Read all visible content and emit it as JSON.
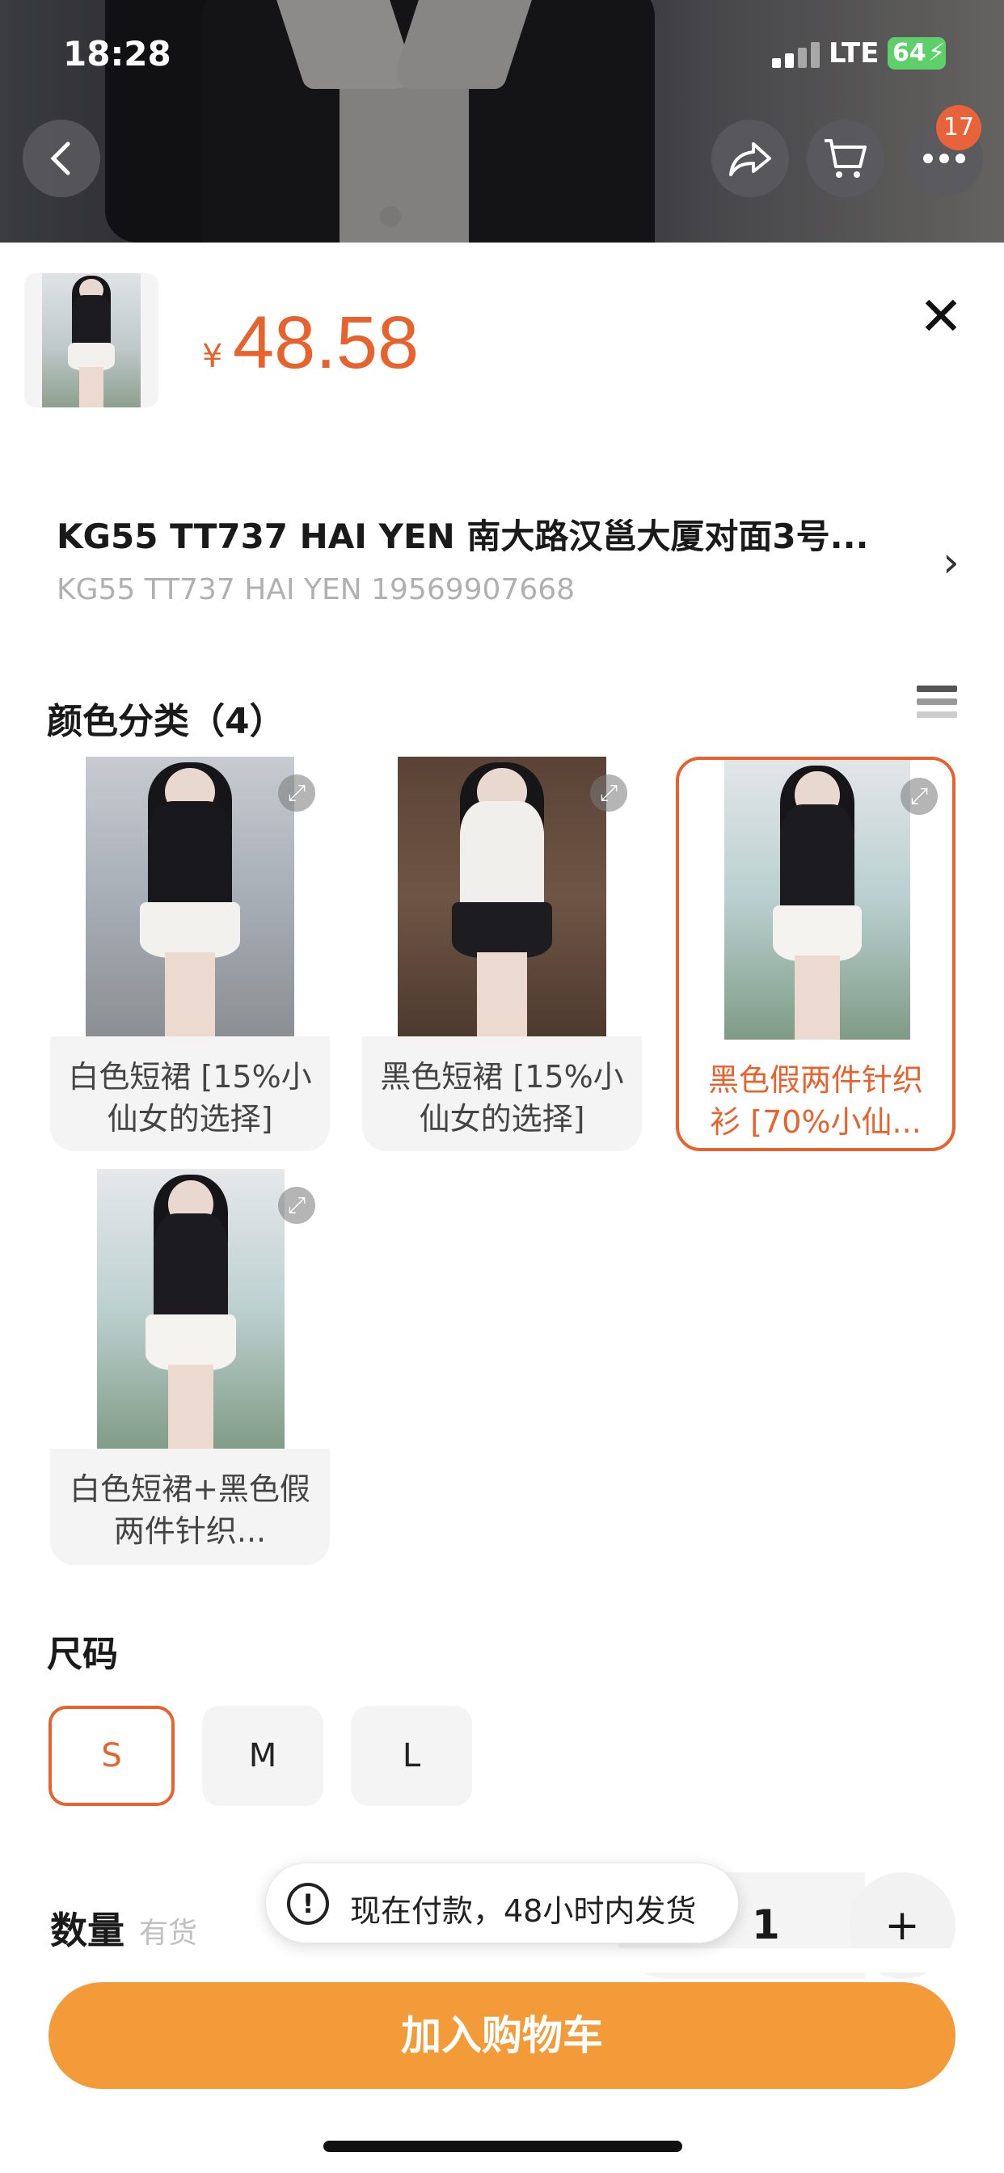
{
  "status_bar": {
    "time": "18:28",
    "network": "LTE",
    "battery": "64"
  },
  "header": {
    "cart_badge": "17",
    "icons": {
      "back": "chevron-left-icon",
      "share": "share-icon",
      "cart": "cart-icon",
      "more": "more-dots-icon"
    }
  },
  "product": {
    "currency": "¥",
    "price": "48.58"
  },
  "address": {
    "title": "KG55 TT737 HAI YEN 南大路汉邕大厦对面3号...",
    "subtitle": "KG55 TT737 HAI YEN 19569907668"
  },
  "colors": {
    "title": "颜色分类（4）",
    "options": [
      {
        "label": "白色短裙 [15%小仙女的选择]",
        "selected": false
      },
      {
        "label": "黑色短裙 [15%小仙女的选择]",
        "selected": false
      },
      {
        "label": "黑色假两件针织衫 [70%小仙...",
        "selected": true
      },
      {
        "label": "白色短裙+黑色假两件针织...",
        "selected": false
      }
    ]
  },
  "sizes": {
    "title": "尺码",
    "options": [
      {
        "label": "S",
        "selected": true
      },
      {
        "label": "M",
        "selected": false
      },
      {
        "label": "L",
        "selected": false
      }
    ]
  },
  "quantity": {
    "label": "数量",
    "stock": "有货",
    "value": "1",
    "plus": "+"
  },
  "toast": {
    "message": "现在付款，48小时内发货"
  },
  "cta": {
    "label": "加入购物车"
  },
  "theme": {
    "accent": "#e8622e",
    "cta": "#f29b38"
  }
}
